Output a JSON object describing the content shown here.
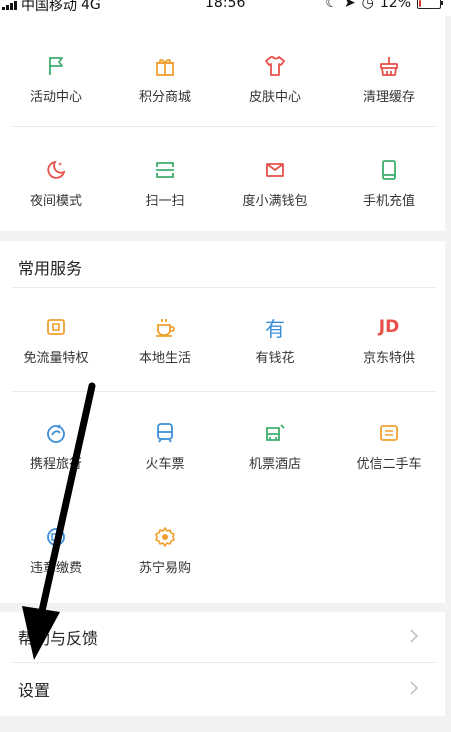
{
  "status_bar": {
    "carrier": "中国移动",
    "network": "4G",
    "time": "18:56",
    "battery": "12%",
    "battery_level": 0.12,
    "battery_color": "#e33333"
  },
  "top_grid": [
    {
      "label": "活动中心",
      "icon": "flag-icon",
      "color": "#3fae6e"
    },
    {
      "label": "积分商城",
      "icon": "gift-icon",
      "color": "#f0a030"
    },
    {
      "label": "皮肤中心",
      "icon": "tshirt-icon",
      "color": "#e8504a"
    },
    {
      "label": "清理缓存",
      "icon": "broom-icon",
      "color": "#e8504a"
    },
    {
      "label": "夜间模式",
      "icon": "moon-icon",
      "color": "#e8504a"
    },
    {
      "label": "扫一扫",
      "icon": "scan-icon",
      "color": "#3fae6e"
    },
    {
      "label": "度小满钱包",
      "icon": "wallet-icon",
      "color": "#e8504a"
    },
    {
      "label": "手机充值",
      "icon": "phone-icon",
      "color": "#3fae6e"
    }
  ],
  "common_services": {
    "title": "常用服务",
    "items": [
      {
        "label": "免流量特权",
        "icon": "sim-card-icon",
        "color": "#f0a030"
      },
      {
        "label": "本地生活",
        "icon": "coffee-cup-icon",
        "color": "#f0a030"
      },
      {
        "label": "有钱花",
        "icon": "you-char-icon",
        "color": "#3a8fd8",
        "glyph": "有"
      },
      {
        "label": "京东特供",
        "icon": "jd-logo-icon",
        "color": "#e8504a",
        "glyph": "JD"
      },
      {
        "label": "携程旅行",
        "icon": "dolphin-icon",
        "color": "#3a8fd8"
      },
      {
        "label": "火车票",
        "icon": "train-icon",
        "color": "#3a8fd8"
      },
      {
        "label": "机票酒店",
        "icon": "plane-hotel-icon",
        "color": "#3fae6e"
      },
      {
        "label": "优信二手车",
        "icon": "car-icon",
        "color": "#f0a030"
      },
      {
        "label": "违章缴费",
        "icon": "fine-badge-icon",
        "color": "#3a8fd8"
      },
      {
        "label": "苏宁易购",
        "icon": "suning-lion-icon",
        "color": "#f0a030"
      }
    ]
  },
  "settings_list": [
    {
      "label": "帮助与反馈"
    },
    {
      "label": "设置"
    }
  ],
  "colors": {
    "background": "#f2f2f2",
    "card": "#ffffff",
    "annotation_arrow": "#000000"
  }
}
